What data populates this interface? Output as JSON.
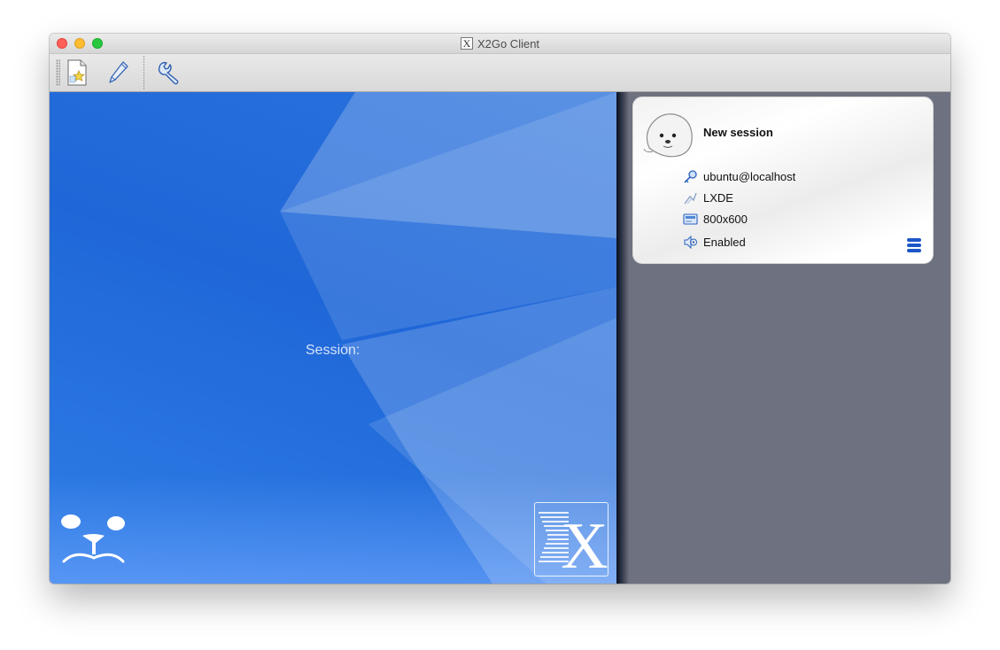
{
  "window": {
    "title": "X2Go Client"
  },
  "toolbar": {
    "buttons": [
      {
        "name": "new-session",
        "icon": "new-session-icon"
      },
      {
        "name": "edit-session",
        "icon": "pencil-icon"
      },
      {
        "name": "preferences",
        "icon": "wrench-icon"
      }
    ]
  },
  "main": {
    "session_label": "Session:"
  },
  "session_card": {
    "name": "New session",
    "user_host": "ubuntu@localhost",
    "session_type": "LXDE",
    "resolution": "800x600",
    "sound": "Enabled"
  },
  "colors": {
    "left_pane_blue": "#1f67d8",
    "right_pane_gray": "#6e717f",
    "menu_button_blue": "#1c57c8"
  }
}
